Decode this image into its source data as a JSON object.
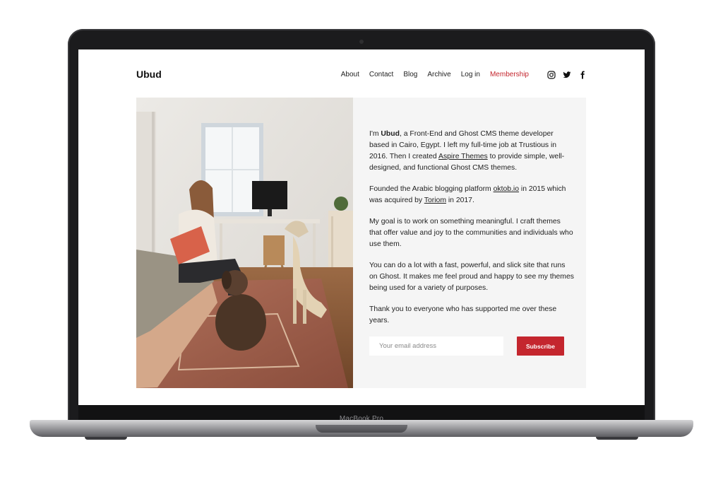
{
  "device": {
    "model": "MacBook Pro"
  },
  "site": {
    "logo": "Ubud",
    "nav": [
      {
        "label": "About"
      },
      {
        "label": "Contact"
      },
      {
        "label": "Blog"
      },
      {
        "label": "Archive"
      },
      {
        "label": "Log in"
      },
      {
        "label": "Membership",
        "highlighted": true
      }
    ],
    "social_icons": [
      "instagram-icon",
      "twitter-icon",
      "facebook-icon"
    ],
    "accent_color": "#c4262e"
  },
  "bio": {
    "p1_prefix": "I'm ",
    "p1_name": "Ubud",
    "p1_mid": ", a Front-End and Ghost CMS theme developer based in Cairo, Egypt. I left my full-time job at Trustious in 2016. Then I created ",
    "p1_link": "Aspire Themes",
    "p1_suffix": " to provide simple, well-designed, and functional Ghost CMS themes.",
    "p2_prefix": "Founded the Arabic blogging platform ",
    "p2_link1": "oktob.io",
    "p2_mid": " in 2015 which was acquired by ",
    "p2_link2": "Toriom",
    "p2_suffix": " in 2017.",
    "p3": "My goal is to work on something meaningful. I craft themes that offer value and joy to the communities and individuals who use them.",
    "p4": "You can do a lot with a fast, powerful, and slick site that runs on Ghost. It makes me feel proud and happy to see my themes being used for a variety of purposes.",
    "p5": "Thank you to everyone who has supported me over these years."
  },
  "subscribe": {
    "placeholder": "Your email address",
    "button_label": "Subscribe"
  }
}
